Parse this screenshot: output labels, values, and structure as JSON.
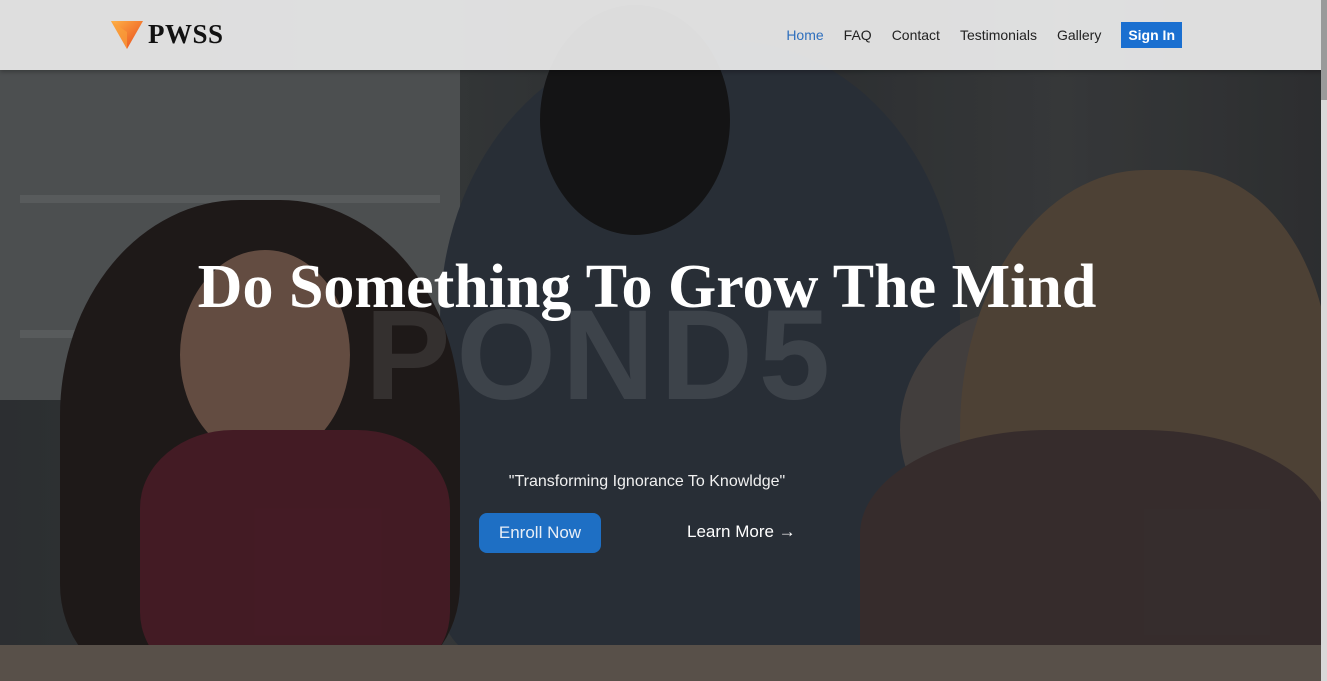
{
  "brand": {
    "name": "PWSS",
    "accent": "#f5782a"
  },
  "nav": {
    "items": [
      {
        "label": "Home",
        "active": true
      },
      {
        "label": "FAQ",
        "active": false
      },
      {
        "label": "Contact",
        "active": false
      },
      {
        "label": "Testimonials",
        "active": false
      },
      {
        "label": "Gallery",
        "active": false
      }
    ],
    "sign_in_label": "Sign In",
    "sign_in_color": "#1a6fd0"
  },
  "hero": {
    "headline": "Do Something To Grow The Mind",
    "tagline": "\"Transforming Ignorance To Knowldge\"",
    "enroll_label": "Enroll Now",
    "learn_more_label": "Learn More →",
    "watermark": "POND5"
  }
}
